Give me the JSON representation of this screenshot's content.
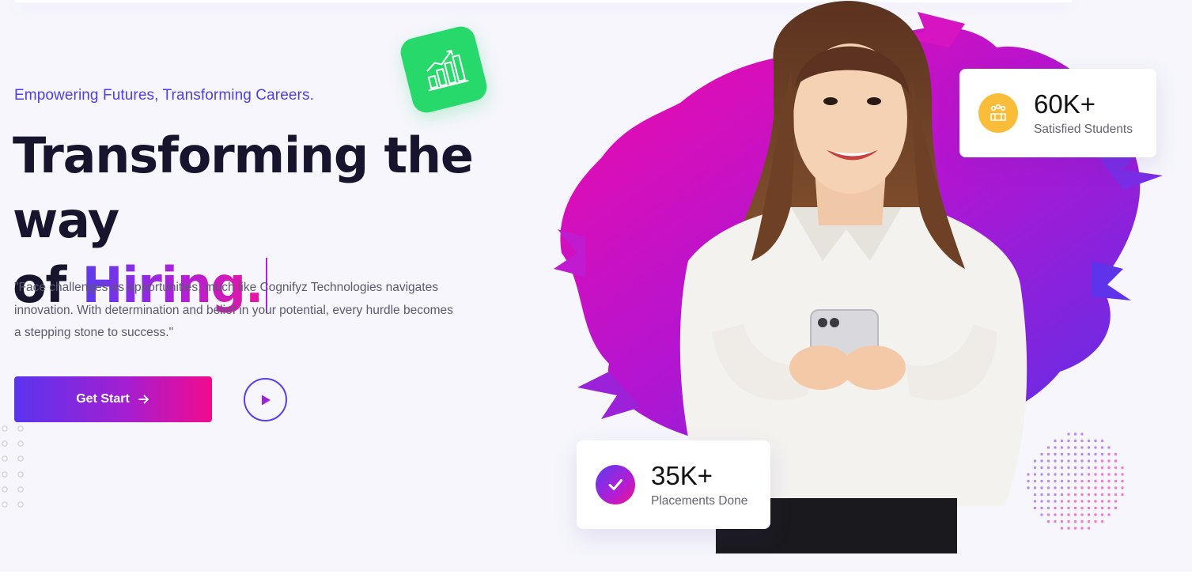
{
  "hero": {
    "tagline": "Empowering Futures, Transforming Careers.",
    "headline_line1": "Transforming the way",
    "headline_of": "of ",
    "headline_highlight": "Hiring.",
    "quote": "\"Face challenges as opportunities, much like Cognifyz Technologies navigates innovation. With determination and belief in your potential, every hurdle becomes a stepping stone to success.\"",
    "cta_label": "Get Start",
    "cta_icon": "arrow-right-icon",
    "play_icon": "play-icon"
  },
  "stats": [
    {
      "value": "60K+",
      "label": "Satisfied Students",
      "icon": "students-icon",
      "color": "#f9bd39"
    },
    {
      "value": "35K+",
      "label": "Placements Done",
      "icon": "check-icon",
      "color": "#9b28dc"
    }
  ],
  "badges": {
    "growth_icon": "growth-chart-icon",
    "growth_color": "#27d96a"
  },
  "colors": {
    "brand_purple": "#5b3cf0",
    "brand_pink": "#f20a8e",
    "heading": "#17152d",
    "background": "#f6f6fc"
  }
}
